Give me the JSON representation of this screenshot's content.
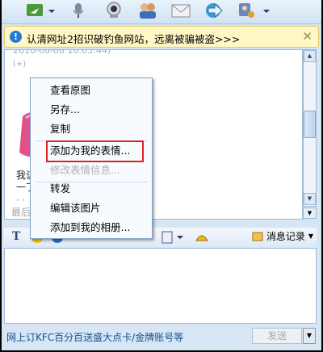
{
  "warning": {
    "text": "认清网址2招识破钓鱼网站，远离被骗被盗>>>",
    "close": "✕"
  },
  "chat": {
    "timestamp": "2010-08-08 10:05:44)",
    "partial1": "我该",
    "partial2": "一丁",
    "partial3": "最后"
  },
  "context_menu": {
    "items": [
      {
        "label": "查看原图",
        "enabled": true
      },
      {
        "label": "另存...",
        "enabled": true
      },
      {
        "label": "复制",
        "enabled": true
      },
      {
        "label": "添加为我的表情...",
        "enabled": true,
        "highlighted": true
      },
      {
        "label": "修改表情信息...",
        "enabled": false
      },
      {
        "label": "转发",
        "enabled": true
      },
      {
        "label": "编辑该图片",
        "enabled": true
      },
      {
        "label": "添加到我的相册...",
        "enabled": true
      }
    ]
  },
  "toolbar2": {
    "font_glyph": "T",
    "message_record": "消息记录"
  },
  "bottom": {
    "link": "网上订KFC百分百送盛大点卡/金牌账号等",
    "send": "发送"
  },
  "colors": {
    "highlight": "#e01f1f",
    "panel": "#d6e6f4"
  },
  "icons": [
    "video-icon",
    "mic-icon",
    "webcam-icon",
    "contacts-icon",
    "mail-icon",
    "network-icon",
    "user-icon",
    "font-icon",
    "emoticon-icon",
    "shake-icon",
    "image-icon",
    "screenshot-icon",
    "message-record-icon"
  ]
}
